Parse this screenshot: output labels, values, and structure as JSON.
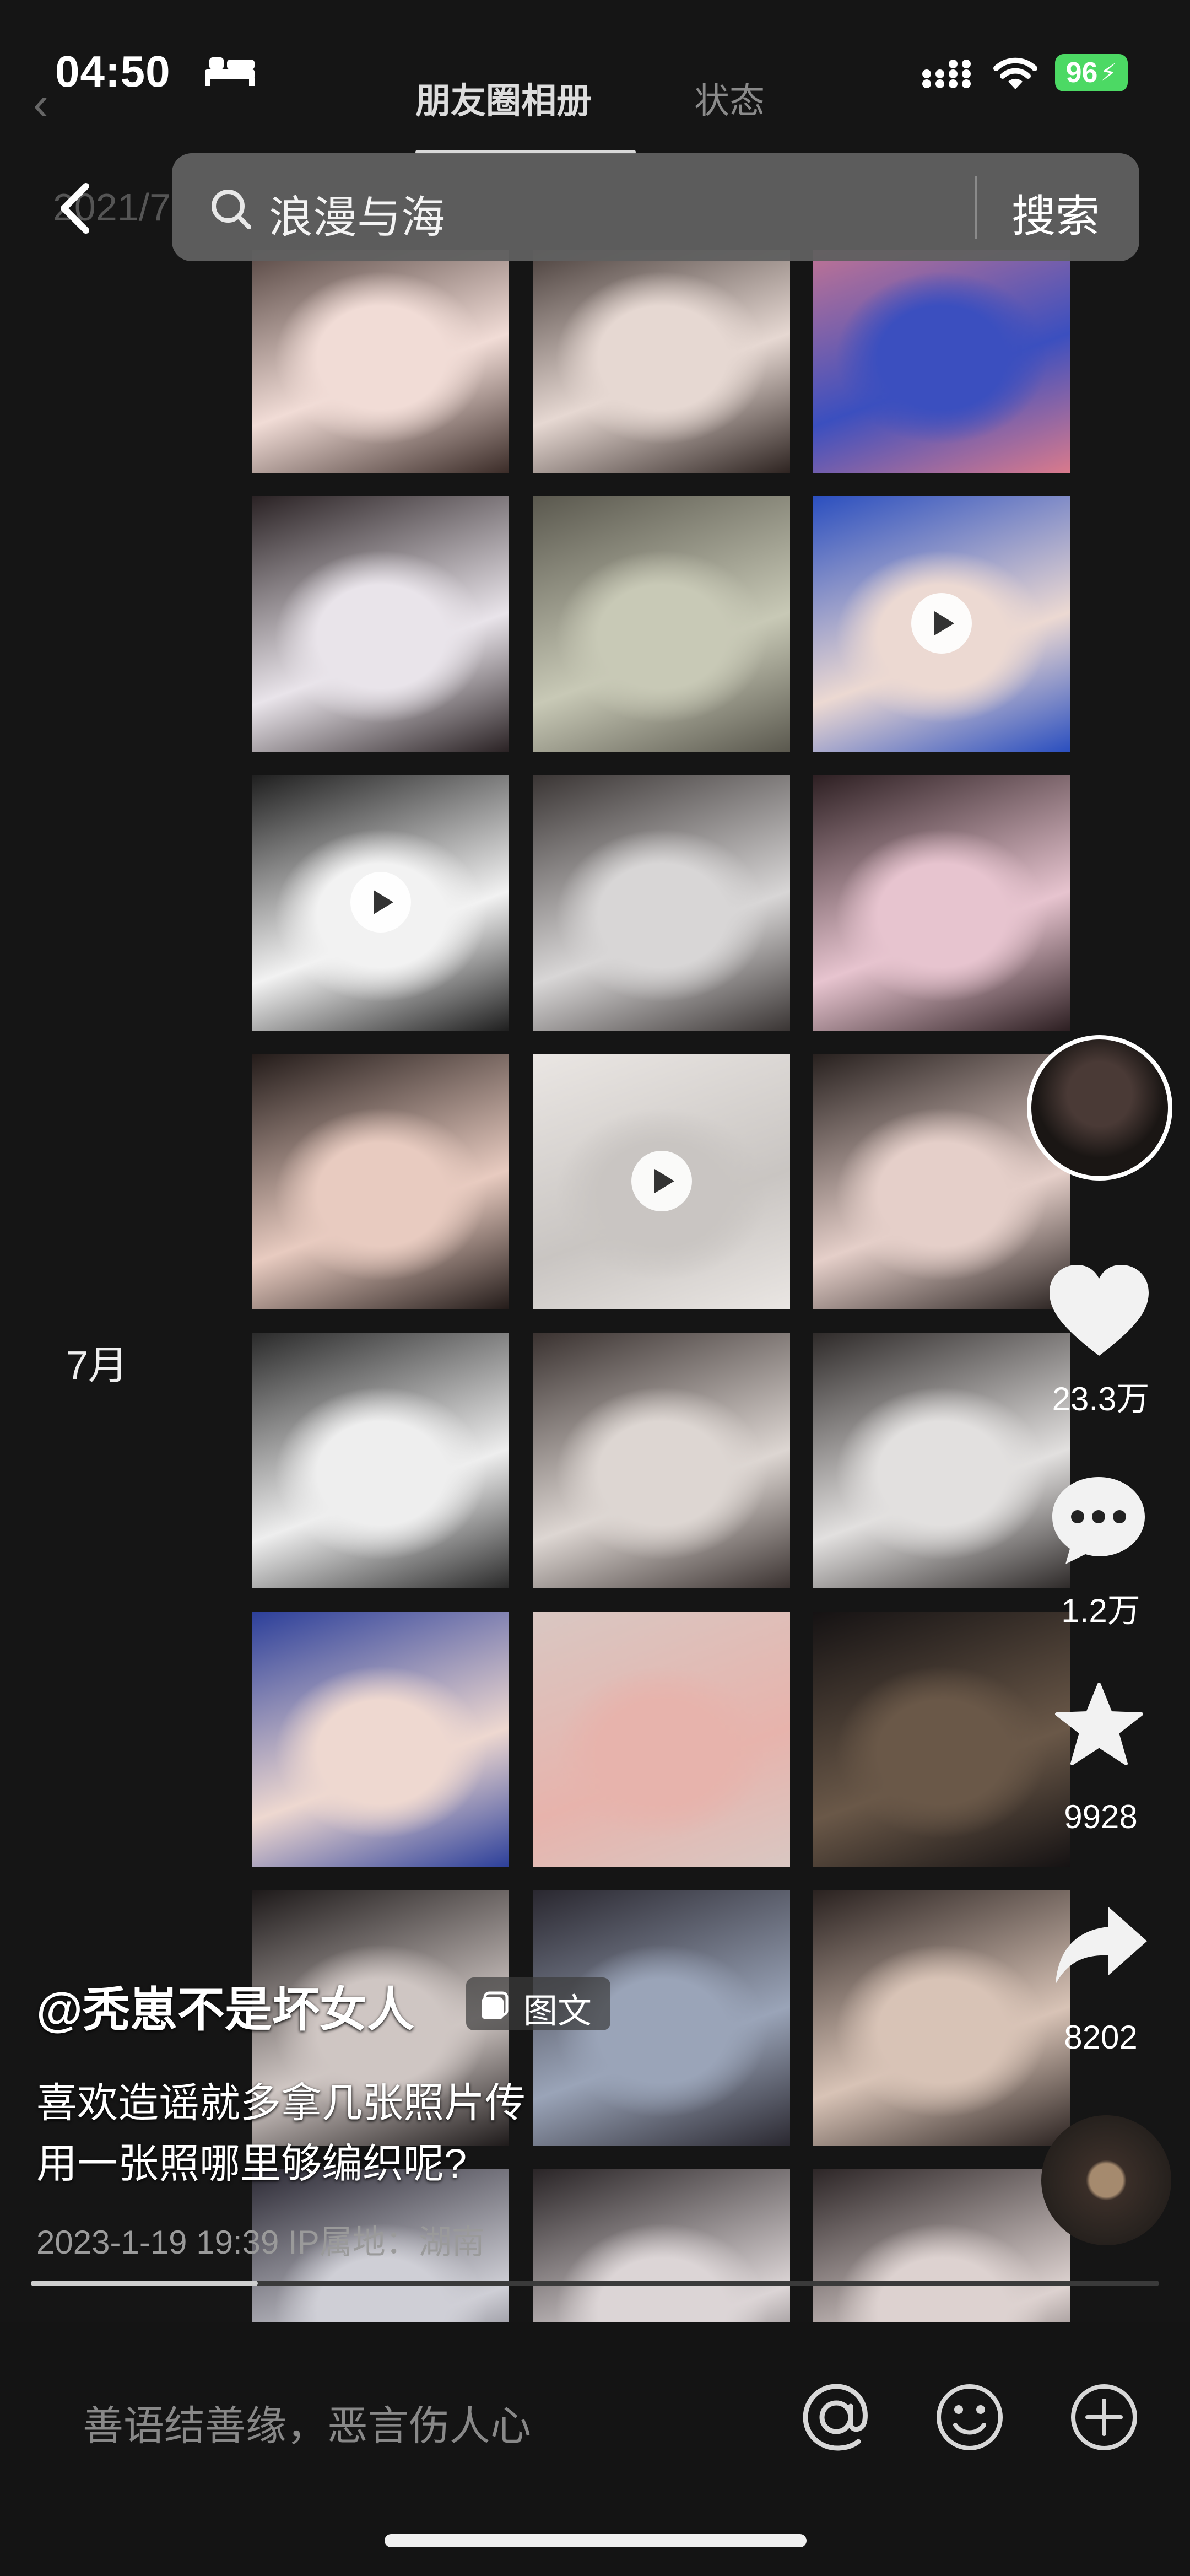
{
  "status_bar": {
    "time": "04:50",
    "battery": "96",
    "accent_battery": "#4cd964"
  },
  "top_tabs": [
    {
      "label": "朋友圈相册"
    },
    {
      "label": "状态"
    }
  ],
  "faint_date": "2021/7",
  "search": {
    "query": "浪漫与海",
    "button_label": "搜索"
  },
  "grid": {
    "month_label": "7月",
    "cells": [
      {
        "colors": [
          "#f1dcd6",
          "#3b2c28"
        ],
        "play": false
      },
      {
        "colors": [
          "#e6d8d2",
          "#2e2421"
        ],
        "play": false
      },
      {
        "colors": [
          "#3b4fbf",
          "#d97a8c"
        ],
        "play": false
      },
      {
        "colors": [
          "#e9e4ea",
          "#2a2224"
        ],
        "play": false
      },
      {
        "colors": [
          "#c8c9b6",
          "#5a584e"
        ],
        "play": false
      },
      {
        "colors": [
          "#ecd9d2",
          "#2b4fbf"
        ],
        "play": true
      },
      {
        "colors": [
          "#f2f2f2",
          "#1f1f1f"
        ],
        "play": true
      },
      {
        "colors": [
          "#d8d6d6",
          "#3a3534"
        ],
        "play": false
      },
      {
        "colors": [
          "#e7c4cf",
          "#2d1f22"
        ],
        "play": false
      },
      {
        "colors": [
          "#e8cbc0",
          "#231b19"
        ],
        "play": false
      },
      {
        "colors": [
          "#c9c5c2",
          "#eae6e3"
        ],
        "play": true
      },
      {
        "colors": [
          "#e5cfc9",
          "#27201e"
        ],
        "play": false
      },
      {
        "colors": [
          "#eeeeee",
          "#2a2a2a"
        ],
        "play": false
      },
      {
        "colors": [
          "#ddd6d2",
          "#3a3230"
        ],
        "play": false
      },
      {
        "colors": [
          "#e2e0df",
          "#2e2a29"
        ],
        "play": false
      },
      {
        "colors": [
          "#eed8d0",
          "#2c3f9a"
        ],
        "play": false
      },
      {
        "colors": [
          "#e7b3ac",
          "#d9c7c2"
        ],
        "play": false
      },
      {
        "colors": [
          "#6a5848",
          "#151213"
        ],
        "play": false
      },
      {
        "colors": [
          "#cfc6c3",
          "#1e1a1a"
        ],
        "play": false
      },
      {
        "colors": [
          "#9aa4b8",
          "#2a2830"
        ],
        "play": false
      },
      {
        "colors": [
          "#d8c3b6",
          "#2a2220"
        ],
        "play": false
      },
      {
        "colors": [
          "#cfcfd6",
          "#2c2a35"
        ],
        "play": false
      },
      {
        "colors": [
          "#dcd5d6",
          "#2a2527"
        ],
        "play": false
      },
      {
        "colors": [
          "#ddd2d0",
          "#2d2627"
        ],
        "play": false
      }
    ]
  },
  "actions": {
    "likes": "23.3万",
    "comments": "1.2万",
    "favorites": "9928",
    "shares": "8202"
  },
  "post": {
    "author": "@秃崽不是坏女人",
    "type_badge": "图文",
    "caption_line1": "喜欢造谣就多拿几张照片传",
    "caption_line2": "用一张照哪里够编织呢?",
    "meta": "2023-1-19 19:39  IP属地：湖南"
  },
  "comment_bar": {
    "placeholder": "善语结善缘，恶言伤人心"
  }
}
